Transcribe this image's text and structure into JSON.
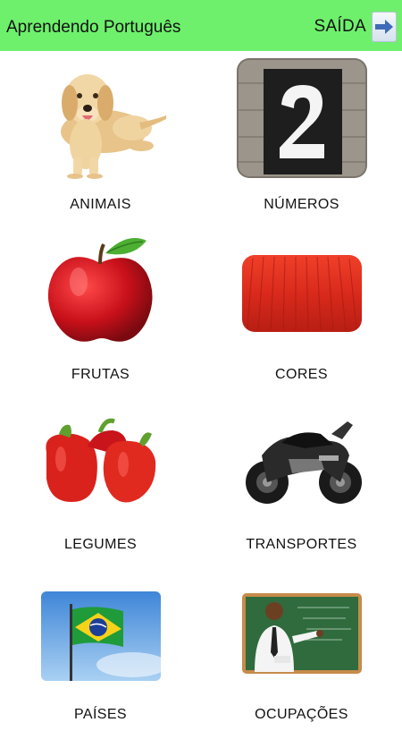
{
  "header": {
    "title": "Aprendendo Português",
    "exit_label": "SAÍDA",
    "background": "#6ef06c",
    "exit_icon": "arrow-right-icon"
  },
  "categories": [
    {
      "label": "ANIMAIS",
      "icon": "dog-image"
    },
    {
      "label": "NÚMEROS",
      "icon": "number-two-image"
    },
    {
      "label": "FRUTAS",
      "icon": "apple-image"
    },
    {
      "label": "CORES",
      "icon": "red-fabric-image"
    },
    {
      "label": "LEGUMES",
      "icon": "red-peppers-image"
    },
    {
      "label": "TRANSPORTES",
      "icon": "motorcycle-image"
    },
    {
      "label": "PAÍSES",
      "icon": "brazil-flag-image"
    },
    {
      "label": "OCUPAÇÕES",
      "icon": "teacher-image"
    }
  ]
}
